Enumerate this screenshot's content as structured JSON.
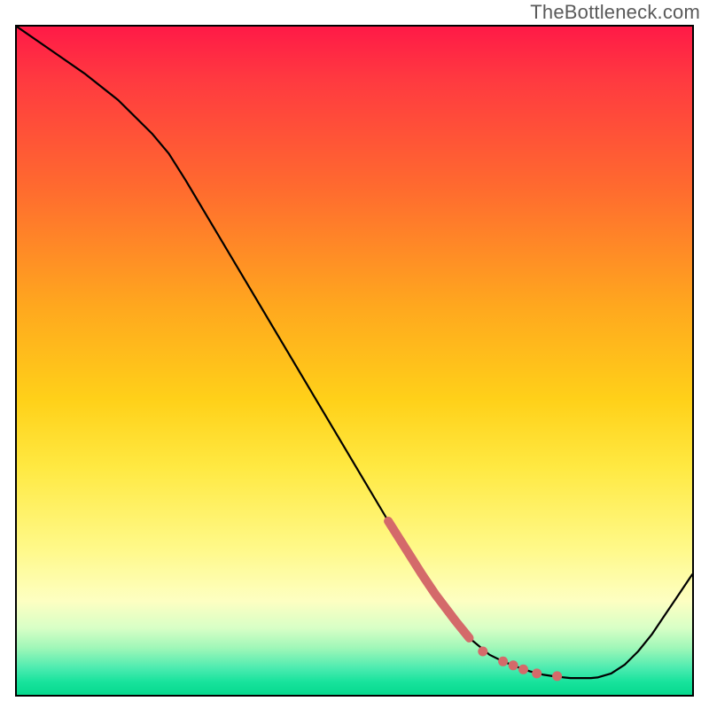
{
  "watermark": "TheBottleneck.com",
  "chart_data": {
    "type": "line",
    "title": "",
    "xlabel": "",
    "ylabel": "",
    "xlim": [
      0,
      100
    ],
    "ylim": [
      0,
      100
    ],
    "grid": false,
    "legend": false,
    "series": [
      {
        "name": "curve",
        "x": [
          0,
          5,
          10,
          15,
          20,
          22.5,
          25,
          30,
          35,
          40,
          45,
          50,
          55,
          60,
          62,
          65,
          67,
          70,
          72,
          74,
          76,
          78,
          80,
          82,
          84,
          85,
          86,
          88,
          90,
          92,
          94,
          96,
          98,
          100
        ],
        "y": [
          100,
          96.5,
          93,
          89,
          84,
          81,
          77,
          68.5,
          60,
          51.5,
          43,
          34.5,
          26,
          18,
          15,
          11,
          8.5,
          6,
          5,
          4.2,
          3.5,
          3,
          2.7,
          2.5,
          2.5,
          2.5,
          2.6,
          3.2,
          4.5,
          6.5,
          9,
          12,
          15,
          18
        ]
      }
    ],
    "highlight_segment": {
      "name": "danger-band",
      "color": "#d46a6a",
      "from_x": 55,
      "to_x": 67
    },
    "highlight_points": {
      "name": "danger-points",
      "color": "#d46a6a",
      "points": [
        {
          "x": 69,
          "y": 6.5
        },
        {
          "x": 72,
          "y": 5.0
        },
        {
          "x": 73.5,
          "y": 4.4
        },
        {
          "x": 75,
          "y": 3.8
        },
        {
          "x": 77,
          "y": 3.2
        },
        {
          "x": 80,
          "y": 2.8
        }
      ]
    }
  }
}
